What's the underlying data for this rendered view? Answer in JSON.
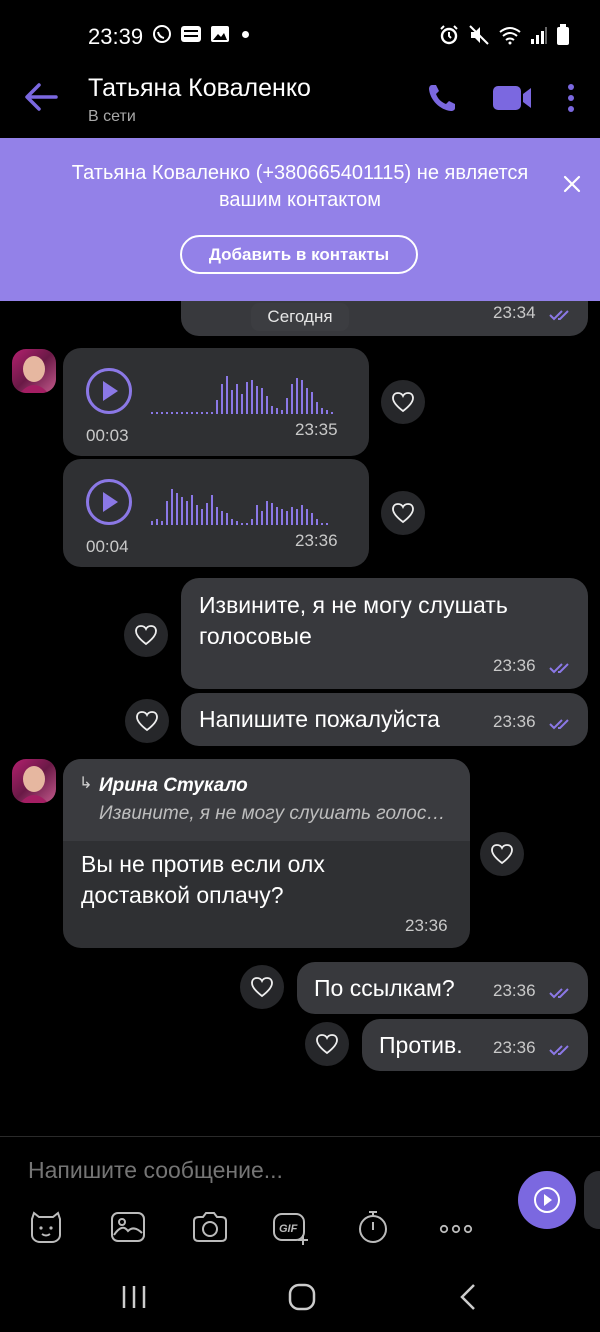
{
  "status_bar": {
    "time": "23:39"
  },
  "header": {
    "contact_name": "Татьяна Коваленко",
    "status": "В сети"
  },
  "banner": {
    "text": "Татьяна Коваленко (+380665401115) не является вашим контактом",
    "button": "Добавить в контакты"
  },
  "chat": {
    "date_separator": "Сегодня",
    "top_partial_time": "23:34",
    "messages": [
      {
        "type": "voice",
        "direction": "in",
        "duration": "00:03",
        "time": "23:35"
      },
      {
        "type": "voice",
        "direction": "in",
        "duration": "00:04",
        "time": "23:36"
      },
      {
        "type": "text",
        "direction": "out",
        "text_line1": "Извините,  я не могу слушать",
        "text_line2": "голосовые",
        "time": "23:36"
      },
      {
        "type": "text",
        "direction": "out",
        "text": "Напишите пожалуйста",
        "time": "23:36"
      },
      {
        "type": "reply",
        "direction": "in",
        "reply_author": "Ирина Стукало",
        "reply_preview": "Извините,  я не могу слушать голосовые",
        "text_line1": "Вы не против если олх",
        "text_line2": "доставкой оплачу?",
        "time": "23:36"
      },
      {
        "type": "text",
        "direction": "out",
        "text": "По ссылкам?",
        "time": "23:36"
      },
      {
        "type": "text",
        "direction": "out",
        "text": "Против.",
        "time": "23:36"
      }
    ]
  },
  "composer": {
    "placeholder": "Напишите сообщение...",
    "tools": [
      "sticker-icon",
      "gallery-icon",
      "camera-icon",
      "gif-icon",
      "timer-icon",
      "more-icon"
    ]
  },
  "colors": {
    "accent": "#7b68e0",
    "banner": "#9381e8",
    "bubble_in": "#2f3033",
    "bubble_out": "#38393d",
    "background": "#000000"
  }
}
